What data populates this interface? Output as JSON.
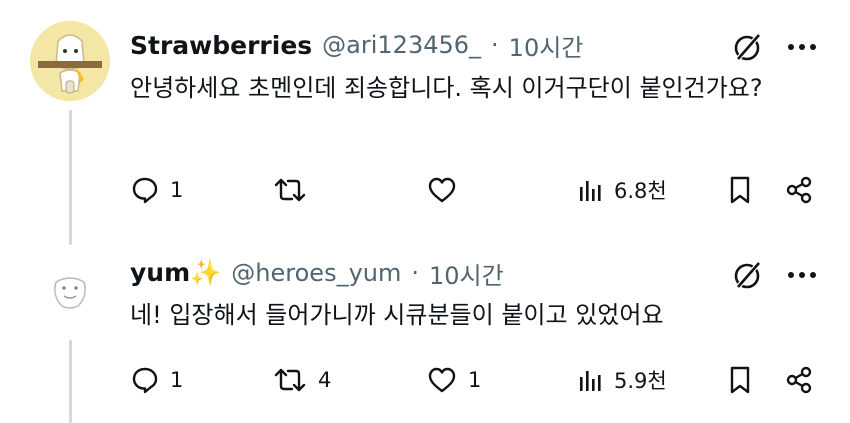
{
  "tweets": [
    {
      "display_name": "Strawberries",
      "handle": "@ari123456_",
      "separator": "·",
      "time": "10시간",
      "text": "안녕하세요 초멘인데 죄송합니다. 혹시 이거구단이 붙인건가요?",
      "actions": {
        "replies": "1",
        "retweets": "",
        "likes": "",
        "views": "6.8천"
      }
    },
    {
      "display_name": "yum",
      "name_emoji": "✨",
      "handle": "@heroes_yum",
      "separator": "·",
      "time": "10시간",
      "text": "네! 입장해서 들어가니까 시큐분들이 붙이고 있었어요",
      "actions": {
        "replies": "1",
        "retweets": "4",
        "likes": "1",
        "views": "5.9천"
      }
    }
  ],
  "colors": {
    "text": "#0f1419",
    "muted": "#536471",
    "thread_line": "#cfd9de",
    "avatar_bg": "#f4e7a6"
  }
}
